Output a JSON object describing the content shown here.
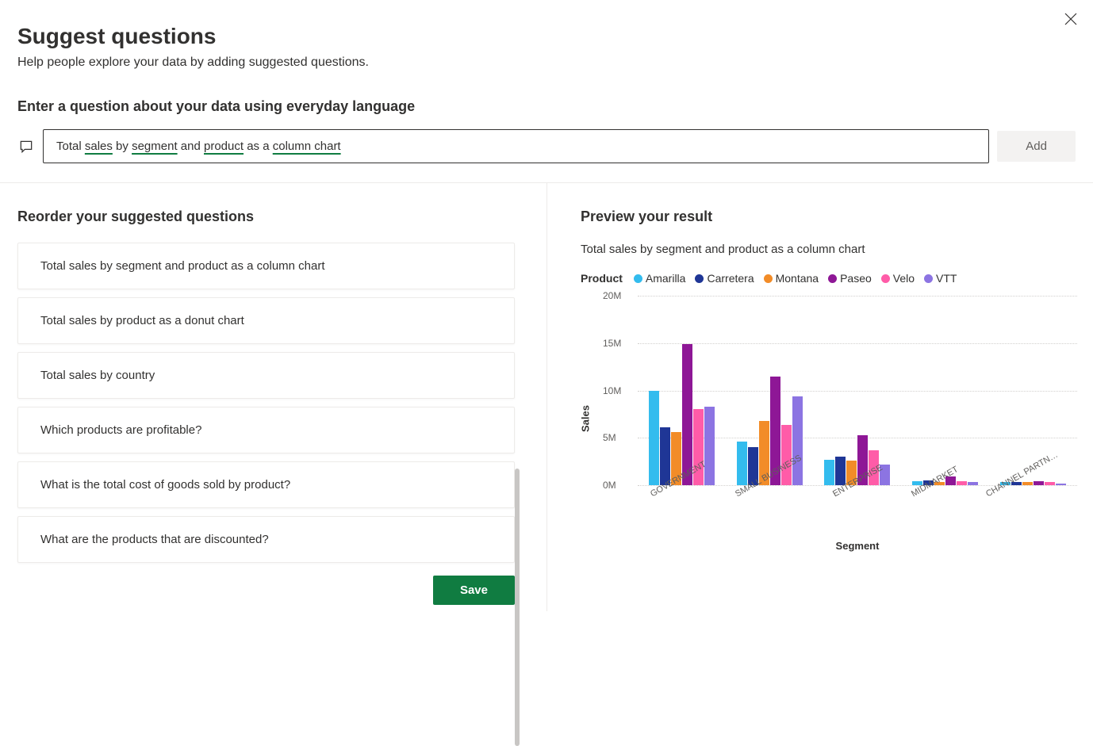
{
  "header": {
    "title": "Suggest questions",
    "subtitle": "Help people explore your data by adding suggested questions.",
    "prompt_label": "Enter a question about your data using everyday language",
    "add_label": "Add"
  },
  "input": {
    "prefix": "Total ",
    "kw1": "sales",
    "mid1": " by ",
    "kw2": "segment",
    "mid2": " and ",
    "kw3": "product",
    "mid3": " as a ",
    "kw4": "column chart"
  },
  "left": {
    "title": "Reorder your suggested questions",
    "questions": [
      "Total sales by segment and product as a column chart",
      "Total sales by product as a donut chart",
      "Total sales by country",
      "Which products are profitable?",
      "What is the total cost of goods sold by product?",
      "What are the products that are discounted?"
    ],
    "save_label": "Save"
  },
  "right": {
    "title": "Preview your result",
    "subtitle": "Total sales by segment and product as a column chart",
    "legend_label": "Product"
  },
  "chart_data": {
    "type": "bar",
    "title": "Total sales by segment and product as a column chart",
    "xlabel": "Segment",
    "ylabel": "Sales",
    "ylim": [
      0,
      20
    ],
    "y_ticks": [
      "0M",
      "5M",
      "10M",
      "15M",
      "20M"
    ],
    "categories": [
      "GOVERNMENT",
      "SMALL BUSINESS",
      "ENTERPRISE",
      "MIDMARKET",
      "CHANNEL PARTN…"
    ],
    "series": [
      {
        "name": "Amarilla",
        "color": "#33bcee",
        "values": [
          10.0,
          4.6,
          2.7,
          0.4,
          0.3
        ]
      },
      {
        "name": "Carretera",
        "color": "#1f3696",
        "values": [
          6.1,
          4.0,
          3.0,
          0.5,
          0.3
        ]
      },
      {
        "name": "Montana",
        "color": "#f28c28",
        "values": [
          5.6,
          6.8,
          2.6,
          0.3,
          0.3
        ]
      },
      {
        "name": "Paseo",
        "color": "#8e1796",
        "values": [
          14.9,
          11.5,
          5.3,
          0.9,
          0.4
        ]
      },
      {
        "name": "Velo",
        "color": "#ff5ca8",
        "values": [
          8.0,
          6.4,
          3.7,
          0.4,
          0.3
        ]
      },
      {
        "name": "VTT",
        "color": "#8c74e2",
        "values": [
          8.3,
          9.4,
          2.2,
          0.3,
          0.2
        ]
      }
    ]
  }
}
